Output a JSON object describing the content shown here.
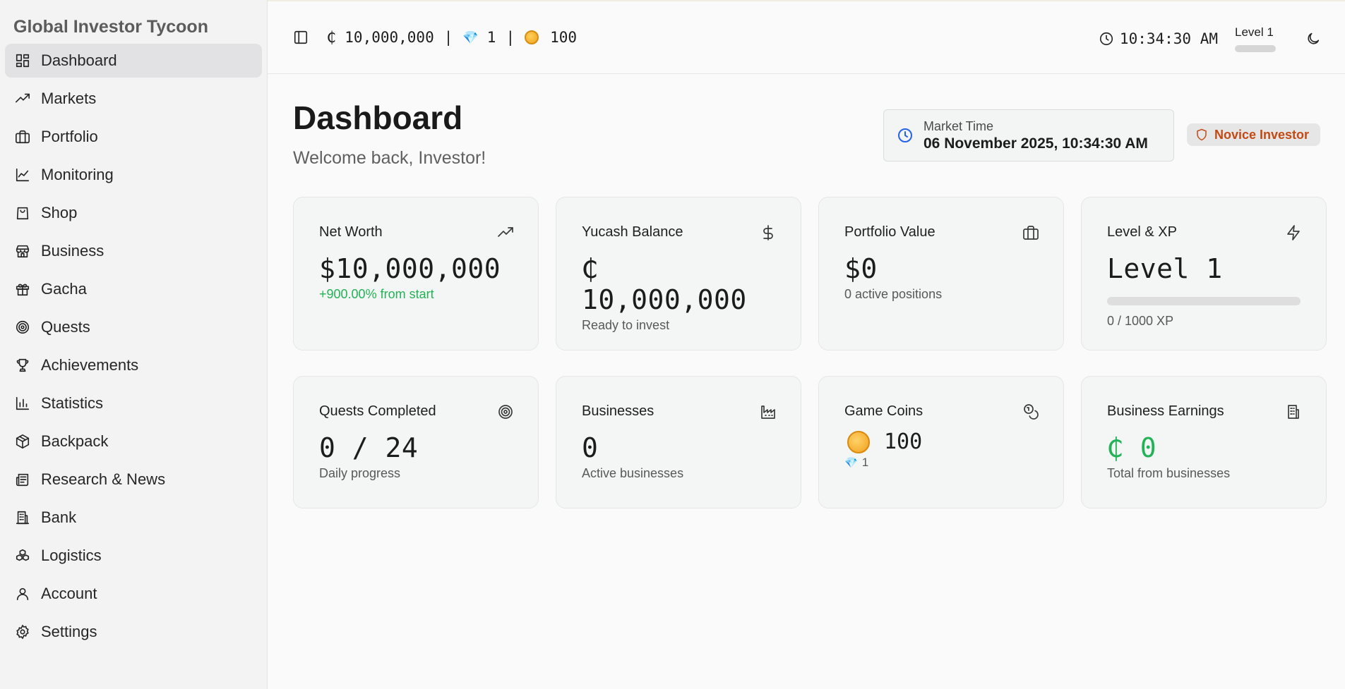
{
  "app": {
    "title": "Global Investor Tycoon"
  },
  "sidebar": {
    "items": [
      {
        "label": "Dashboard",
        "icon": "dashboard-icon",
        "active": true
      },
      {
        "label": "Markets",
        "icon": "trending-up-icon"
      },
      {
        "label": "Portfolio",
        "icon": "briefcase-icon"
      },
      {
        "label": "Monitoring",
        "icon": "line-chart-icon"
      },
      {
        "label": "Shop",
        "icon": "shopping-bag-icon"
      },
      {
        "label": "Business",
        "icon": "store-icon"
      },
      {
        "label": "Gacha",
        "icon": "gift-icon"
      },
      {
        "label": "Quests",
        "icon": "target-icon"
      },
      {
        "label": "Achievements",
        "icon": "trophy-icon"
      },
      {
        "label": "Statistics",
        "icon": "bar-chart-icon"
      },
      {
        "label": "Backpack",
        "icon": "package-icon"
      },
      {
        "label": "Research & News",
        "icon": "newspaper-icon"
      },
      {
        "label": "Bank",
        "icon": "building-icon"
      },
      {
        "label": "Logistics",
        "icon": "boxes-icon"
      },
      {
        "label": "Account",
        "icon": "user-icon"
      },
      {
        "label": "Settings",
        "icon": "gear-icon"
      }
    ]
  },
  "topbar": {
    "balance": "₵ 10,000,000",
    "separator": "|",
    "gems": "1",
    "gem_glyph": "💎",
    "coins": "100",
    "clock": "10:34:30 AM",
    "level": "Level 1",
    "level_progress": 0
  },
  "header": {
    "title": "Dashboard",
    "subtitle": "Welcome back, Investor!",
    "market_time_label": "Market Time",
    "market_time_value": "06 November 2025, 10:34:30 AM",
    "rank": "Novice Investor"
  },
  "cards": {
    "net_worth": {
      "title": "Net Worth",
      "value": "$10,000,000",
      "sub": "+900.00% from start"
    },
    "yucash": {
      "title": "Yucash Balance",
      "value": "₵ 10,000,000",
      "sub": "Ready to invest"
    },
    "portfolio": {
      "title": "Portfolio Value",
      "value": "$0",
      "sub": "0 active positions"
    },
    "level": {
      "title": "Level & XP",
      "value": "Level 1",
      "sub": "0 / 1000 XP",
      "xp_progress": 0
    },
    "quests": {
      "title": "Quests Completed",
      "value": "0 / 24",
      "sub": "Daily progress"
    },
    "businesses": {
      "title": "Businesses",
      "value": "0",
      "sub": "Active businesses"
    },
    "coins": {
      "title": "Game Coins",
      "value": "100",
      "gems": "1"
    },
    "earnings": {
      "title": "Business Earnings",
      "value": "₵ 0",
      "sub": "Total from businesses"
    }
  },
  "colors": {
    "accent_green": "#22b356",
    "rank_orange": "#c24a14",
    "clock_blue": "#2563eb"
  }
}
